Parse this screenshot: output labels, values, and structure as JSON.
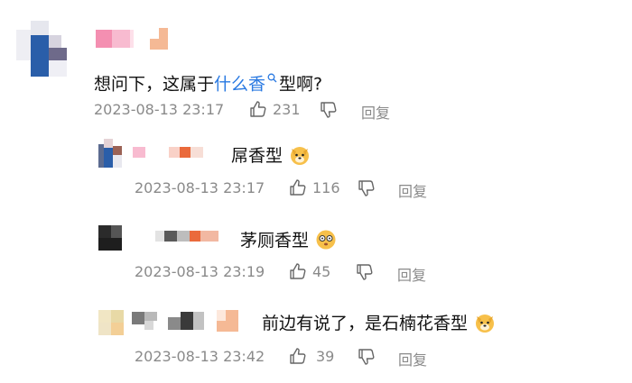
{
  "comments": [
    {
      "text_before": "想问下，这属于",
      "link_text": "什么香",
      "text_after": "型啊?",
      "timestamp": "2023-08-13 23:17",
      "likes": "231",
      "reply_label": "回复"
    }
  ],
  "replies": [
    {
      "text": "屌香型",
      "timestamp": "2023-08-13 23:17",
      "likes": "116",
      "reply_label": "回复",
      "emoji": "dog-face-emoji"
    },
    {
      "text": "茅厕香型",
      "timestamp": "2023-08-13 23:19",
      "likes": "45",
      "reply_label": "回复",
      "emoji": "dizzy-face-emoji"
    },
    {
      "text": "前边有说了，是石楠花香型",
      "timestamp": "2023-08-13 23:42",
      "likes": "39",
      "reply_label": "回复",
      "emoji": "dog-face-emoji"
    }
  ],
  "colors": {
    "link": "#2a7ae2",
    "meta": "#8a8a8a",
    "emoji": "#f7c04a"
  }
}
